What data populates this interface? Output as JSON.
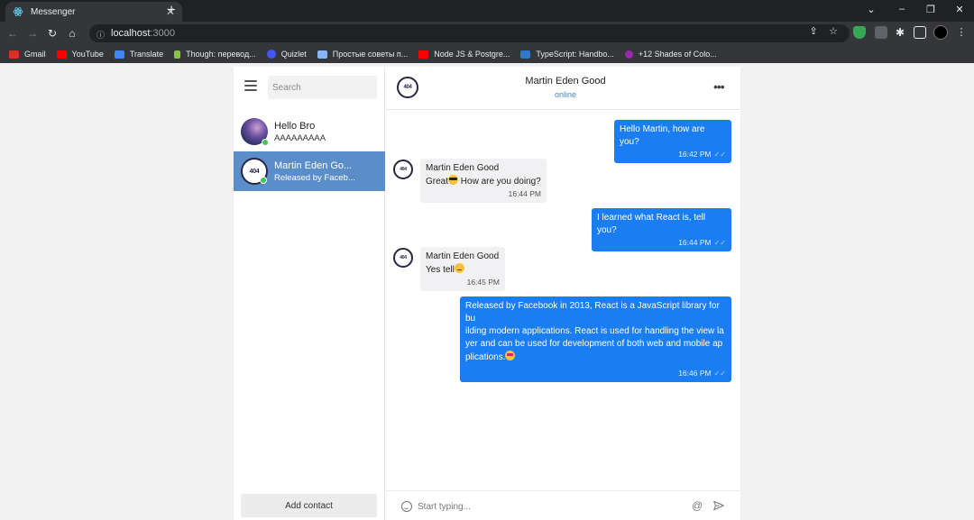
{
  "browser": {
    "tab_title": "Messenger",
    "url_host": "localhost",
    "url_port": ":3000",
    "bookmarks": [
      {
        "label": "Gmail",
        "color": "#d93025"
      },
      {
        "label": "YouTube",
        "color": "#ff0000"
      },
      {
        "label": "Translate",
        "color": "#4285f4"
      },
      {
        "label": "Though: перевод...",
        "color": "#8bc34a"
      },
      {
        "label": "Quizlet",
        "color": "#4255ff"
      },
      {
        "label": "Простые советы п...",
        "color": "#8ab4f8"
      },
      {
        "label": "Node JS & Postgre...",
        "color": "#ff0000"
      },
      {
        "label": "TypeScript: Handbo...",
        "color": "#3178c6"
      },
      {
        "label": "+12 Shades of Colo...",
        "color": "#9c27b0"
      }
    ]
  },
  "sidebar": {
    "search_placeholder": "Search",
    "contacts": [
      {
        "name": "Hello Bro",
        "last": "AAAAAAAAA"
      },
      {
        "name": "Martin Eden Go...",
        "last": "Released by Faceb..."
      }
    ],
    "add_contact_label": "Add contact"
  },
  "chat": {
    "avatar_text": "404",
    "title": "Martin Eden Good",
    "status": "online",
    "messages": [
      {
        "text": "Hello Martin, how are you?",
        "time": "16:42 PM"
      },
      {
        "sender": "Martin Eden Good",
        "text": "Great",
        "text_after": " How are you doing?",
        "time": "16:44 PM"
      },
      {
        "text": "I learned what React is, tell you?",
        "time": "16:44 PM"
      },
      {
        "sender": "Martin Eden Good",
        "text": "Yes tell",
        "time": "16:45 PM"
      },
      {
        "lines": [
          "Released by Facebook in 2013, React is a JavaScript library for bu",
          "ilding modern applications. React is used for handling the view la",
          "yer and can be used for development of both web and mobile ap",
          "plications."
        ],
        "time": "16:46 PM"
      }
    ],
    "composer_placeholder": "Start typing..."
  },
  "colors": {
    "accent": "#1a7ef2",
    "selected_contact": "#5b8dc9",
    "online": "#44c553"
  }
}
